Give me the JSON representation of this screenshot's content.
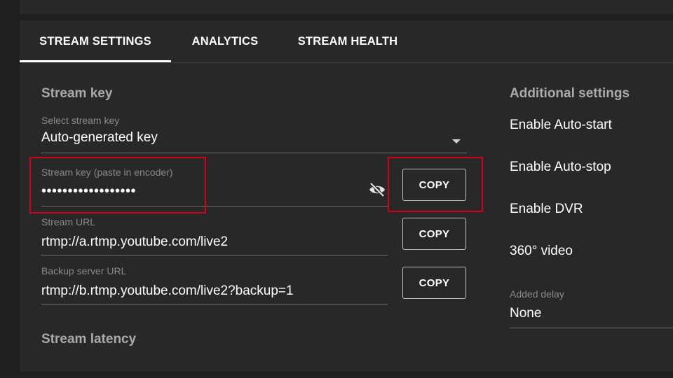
{
  "tabs": [
    {
      "label": "STREAM SETTINGS",
      "active": true
    },
    {
      "label": "ANALYTICS",
      "active": false
    },
    {
      "label": "STREAM HEALTH",
      "active": false
    }
  ],
  "stream_key_section": {
    "title": "Stream key",
    "select": {
      "label": "Select stream key",
      "value": "Auto-generated key"
    },
    "stream_key_field": {
      "label": "Stream key (paste in encoder)",
      "value": "••••••••••••••••••",
      "copy_label": "COPY",
      "visibility_icon": "eye-off-icon"
    },
    "stream_url_field": {
      "label": "Stream URL",
      "value": "rtmp://a.rtmp.youtube.com/live2",
      "copy_label": "COPY"
    },
    "backup_url_field": {
      "label": "Backup server URL",
      "value": "rtmp://b.rtmp.youtube.com/live2?backup=1",
      "copy_label": "COPY"
    }
  },
  "latency_section": {
    "title": "Stream latency"
  },
  "additional_settings": {
    "title": "Additional settings",
    "items": [
      "Enable Auto-start",
      "Enable Auto-stop",
      "Enable DVR",
      "360° video"
    ],
    "added_delay": {
      "label": "Added delay",
      "value": "None"
    }
  },
  "colors": {
    "background": "#1f1f1f",
    "panel": "#282828",
    "highlight": "#d0021b",
    "text": "#ffffff",
    "muted_text": "#aaaaaa"
  }
}
